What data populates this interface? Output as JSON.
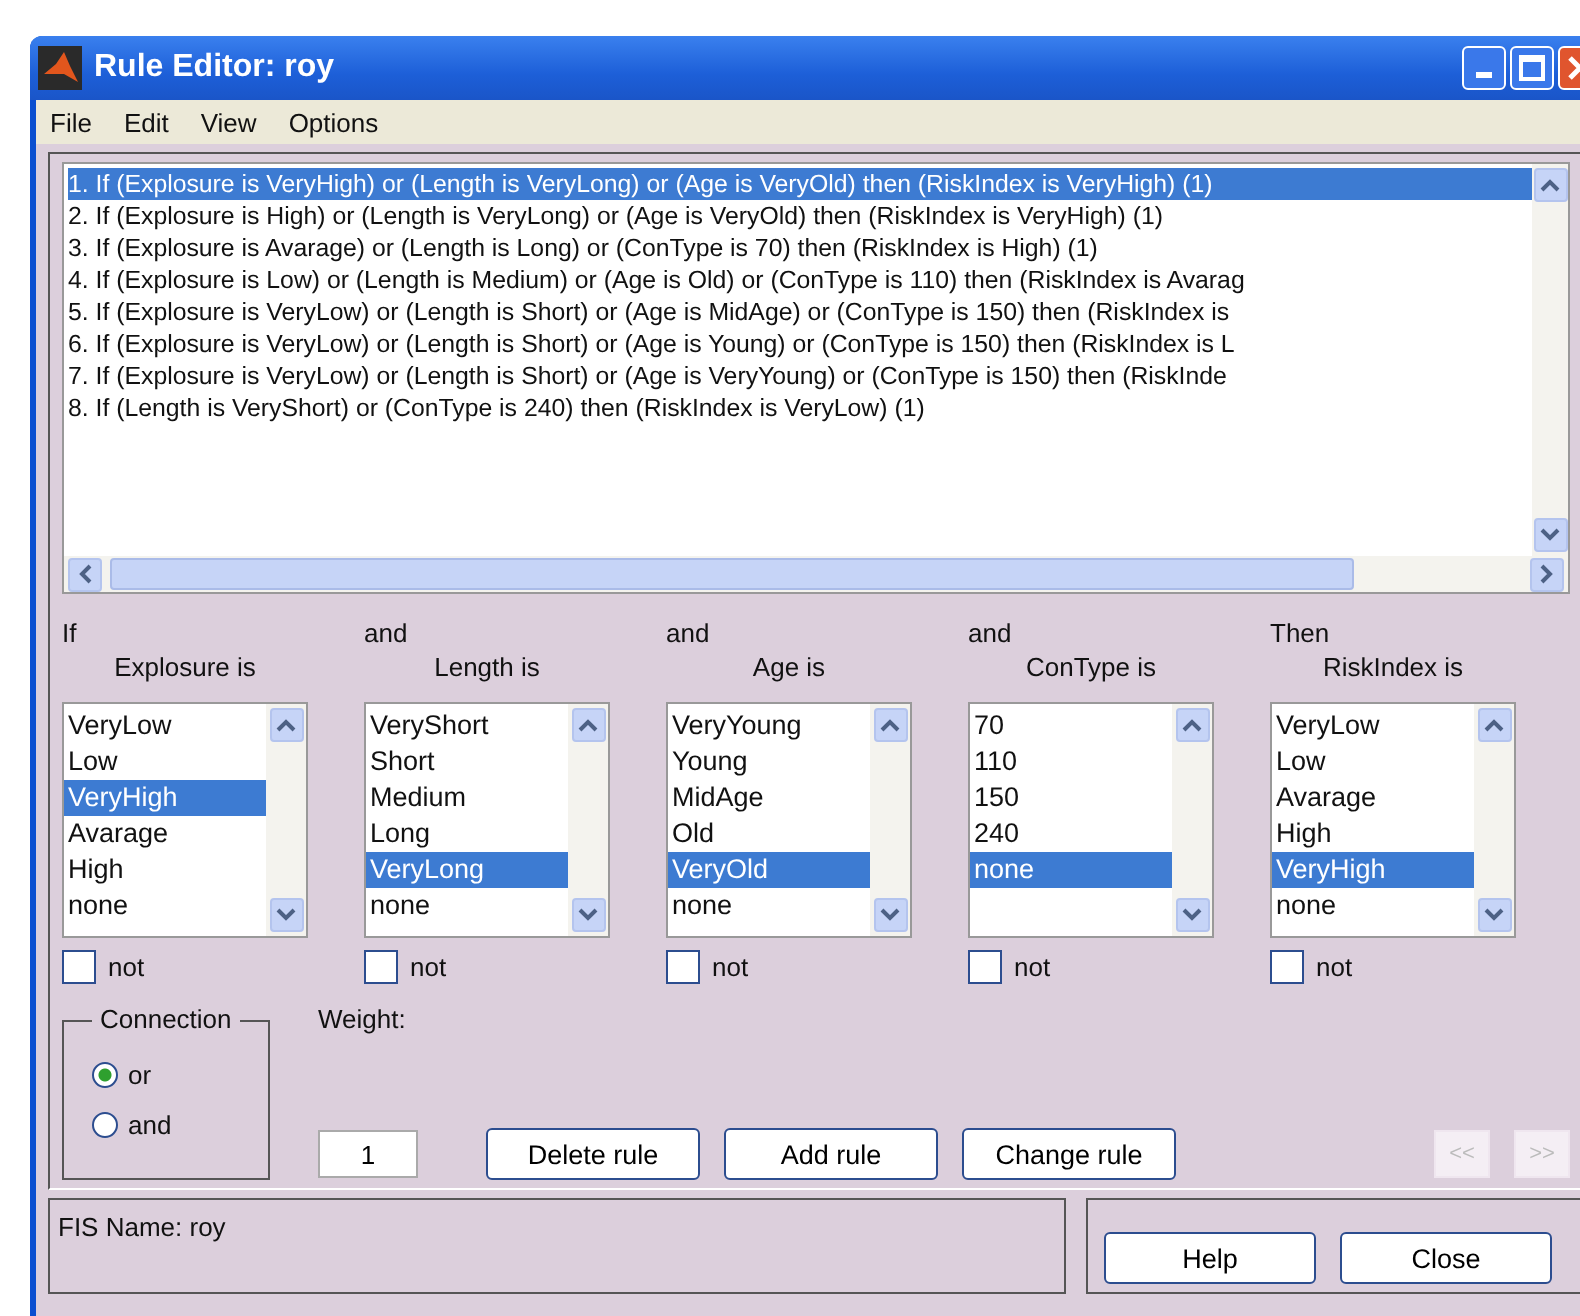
{
  "window": {
    "title": "Rule Editor: roy"
  },
  "menu": [
    "File",
    "Edit",
    "View",
    "Options"
  ],
  "rules": [
    {
      "text": "1. If (Explosure is VeryHigh) or (Length is VeryLong) or (Age is VeryOld) then (RiskIndex is VeryHigh) (1)",
      "selected": true
    },
    {
      "text": "2. If (Explosure is High) or (Length is VeryLong) or (Age is VeryOld) then (RiskIndex is VeryHigh) (1)",
      "selected": false
    },
    {
      "text": "3. If (Explosure is Avarage) or (Length is Long) or (ConType is 70) then (RiskIndex is High) (1)",
      "selected": false
    },
    {
      "text": "4. If (Explosure is Low) or (Length is Medium) or (Age is Old) or (ConType is 110) then (RiskIndex is Avarag",
      "selected": false
    },
    {
      "text": "5. If (Explosure is VeryLow) or (Length is Short) or (Age is MidAge) or (ConType is 150) then (RiskIndex is",
      "selected": false
    },
    {
      "text": "6. If (Explosure is VeryLow) or (Length is Short) or (Age is Young) or (ConType is 150) then (RiskIndex is L",
      "selected": false
    },
    {
      "text": "7. If (Explosure is VeryLow) or (Length is Short) or (Age is VeryYoung) or (ConType is 150) then (RiskInde",
      "selected": false
    },
    {
      "text": "8. If (Length is VeryShort) or (ConType is 240) then (RiskIndex is VeryLow) (1)",
      "selected": false
    }
  ],
  "columns": [
    {
      "connector": "If",
      "label": "Explosure is",
      "not_label": "not",
      "not_checked": false,
      "items": [
        {
          "text": "VeryLow",
          "selected": false
        },
        {
          "text": "Low",
          "selected": false
        },
        {
          "text": "VeryHigh",
          "selected": true
        },
        {
          "text": "Avarage",
          "selected": false
        },
        {
          "text": "High",
          "selected": false
        },
        {
          "text": "none",
          "selected": false
        }
      ]
    },
    {
      "connector": "and",
      "label": "Length is",
      "not_label": "not",
      "not_checked": false,
      "items": [
        {
          "text": "VeryShort",
          "selected": false
        },
        {
          "text": "Short",
          "selected": false
        },
        {
          "text": "Medium",
          "selected": false
        },
        {
          "text": "Long",
          "selected": false
        },
        {
          "text": "VeryLong",
          "selected": true
        },
        {
          "text": "none",
          "selected": false
        }
      ]
    },
    {
      "connector": "and",
      "label": "Age is",
      "not_label": "not",
      "not_checked": false,
      "items": [
        {
          "text": "VeryYoung",
          "selected": false
        },
        {
          "text": "Young",
          "selected": false
        },
        {
          "text": "MidAge",
          "selected": false
        },
        {
          "text": "Old",
          "selected": false
        },
        {
          "text": "VeryOld",
          "selected": true
        },
        {
          "text": "none",
          "selected": false
        }
      ]
    },
    {
      "connector": "and",
      "label": "ConType is",
      "not_label": "not",
      "not_checked": false,
      "items": [
        {
          "text": "70",
          "selected": false
        },
        {
          "text": "110",
          "selected": false
        },
        {
          "text": "150",
          "selected": false
        },
        {
          "text": "240",
          "selected": false
        },
        {
          "text": "none",
          "selected": true
        }
      ]
    },
    {
      "connector": "Then",
      "label": "RiskIndex is",
      "not_label": "not",
      "not_checked": false,
      "items": [
        {
          "text": "VeryLow",
          "selected": false
        },
        {
          "text": "Low",
          "selected": false
        },
        {
          "text": "Avarage",
          "selected": false
        },
        {
          "text": "High",
          "selected": false
        },
        {
          "text": "VeryHigh",
          "selected": true
        },
        {
          "text": "none",
          "selected": false
        }
      ]
    }
  ],
  "connection": {
    "title": "Connection",
    "options": [
      {
        "label": "or",
        "selected": true
      },
      {
        "label": "and",
        "selected": false
      }
    ]
  },
  "weight": {
    "label": "Weight:",
    "value": "1"
  },
  "actions": [
    "Delete rule",
    "Add rule",
    "Change rule"
  ],
  "nav": [
    {
      "label": "<<",
      "disabled": true
    },
    {
      "label": ">>",
      "disabled": true
    }
  ],
  "status": "FIS Name: roy",
  "footer_buttons": [
    "Help",
    "Close"
  ]
}
